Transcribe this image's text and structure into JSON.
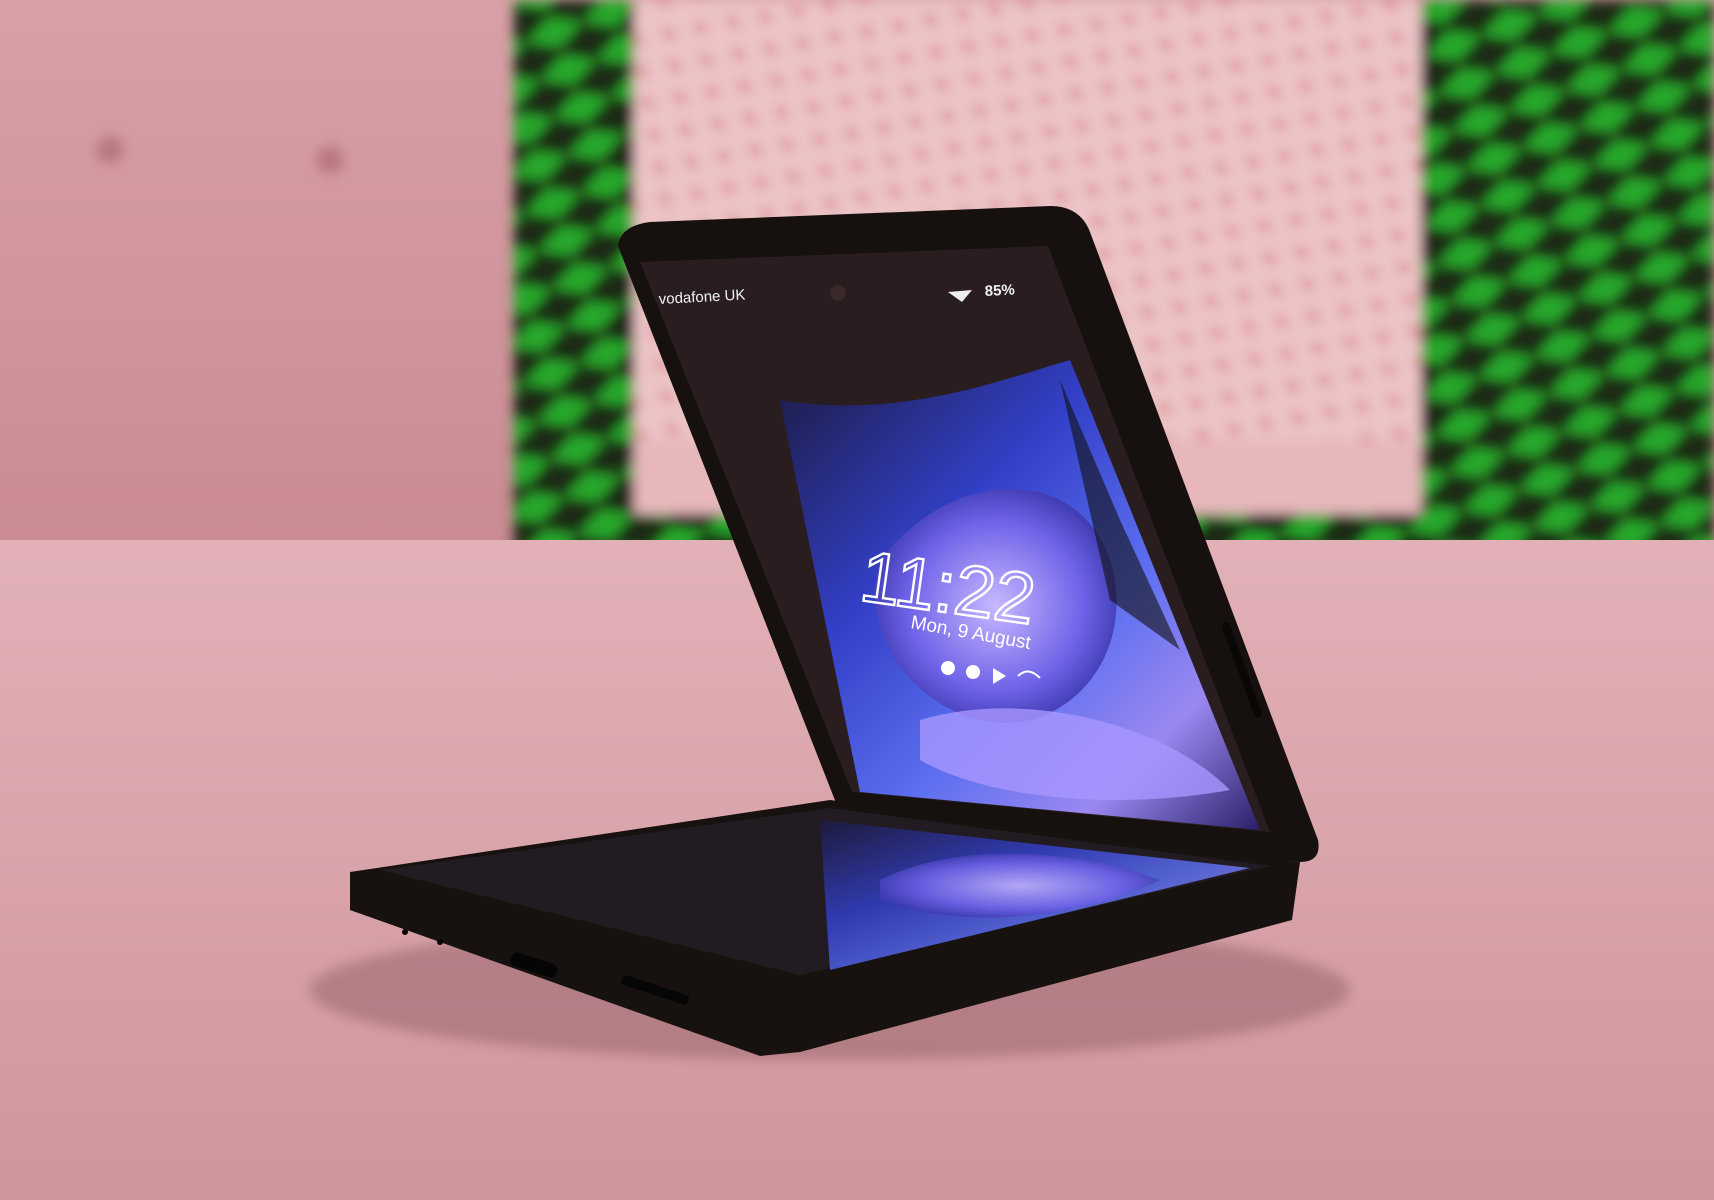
{
  "photo": {
    "subject": "foldable-phone",
    "colors": {
      "couch": "#d79aa2",
      "seat": "#d6a1a8",
      "pillow_frame": "#1e8a1e",
      "pillow_inner": "#e8b9bd",
      "phone_body": "#1a1416",
      "wallpaper": "#4a4fe0"
    }
  },
  "screen": {
    "carrier": "vodafone UK",
    "battery": "85%",
    "time": "11:22",
    "date": "Mon, 9 August"
  }
}
